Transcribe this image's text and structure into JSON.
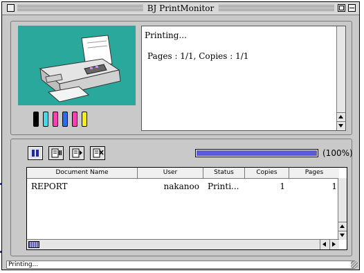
{
  "window": {
    "title": "BJ PrintMonitor"
  },
  "message": {
    "line1": "Printing...",
    "line2": "Pages :  1/1, Copies :  1/1"
  },
  "inks": [
    "#000000",
    "#47d8e8",
    "#ff3db4",
    "#2a6cf0",
    "#ff3db4",
    "#f6ee1c"
  ],
  "toolbar": {
    "icons": [
      "pause-icon",
      "pause-document-icon",
      "resume-document-icon",
      "delete-document-icon"
    ]
  },
  "progress": {
    "fraction": 1.0,
    "label": "(100%)",
    "fill_color": "#5b5bd6"
  },
  "table": {
    "columns": [
      "Document Name",
      "User",
      "Status",
      "Copies",
      "Pages"
    ],
    "rows": [
      {
        "document": "REPORT",
        "user": "nakanoo",
        "status": "Printi...",
        "copies": "1",
        "pages": "1"
      }
    ]
  },
  "status_bar": {
    "text": "Printing..."
  }
}
